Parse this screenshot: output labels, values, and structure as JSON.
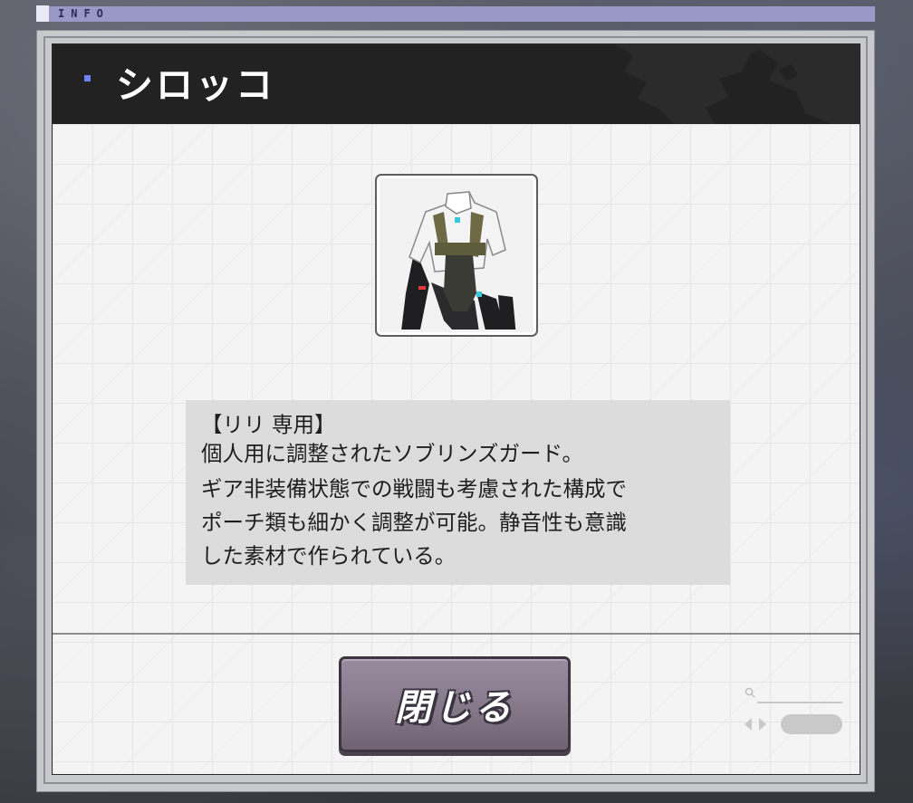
{
  "top_bar": {
    "tab_label": "INFO"
  },
  "dialog": {
    "title": "シロッコ",
    "item_icon": "sirocco-outfit-icon",
    "description_lines": [
      "【リリ 専用】",
      "個人用に調整されたソブリンズガード。",
      "ギア非装備状態での戦闘も考慮された構成で",
      "ポーチ類も細かく調整が可能。静音性も意識",
      "した素材で作られている。"
    ],
    "close_label": "閉じる"
  },
  "colors": {
    "header_bg": "#222222",
    "accent_dot": "#6f84f2",
    "top_strip": "#9a98c6",
    "button": "#857889",
    "description_bg": "#dcdcdc"
  }
}
